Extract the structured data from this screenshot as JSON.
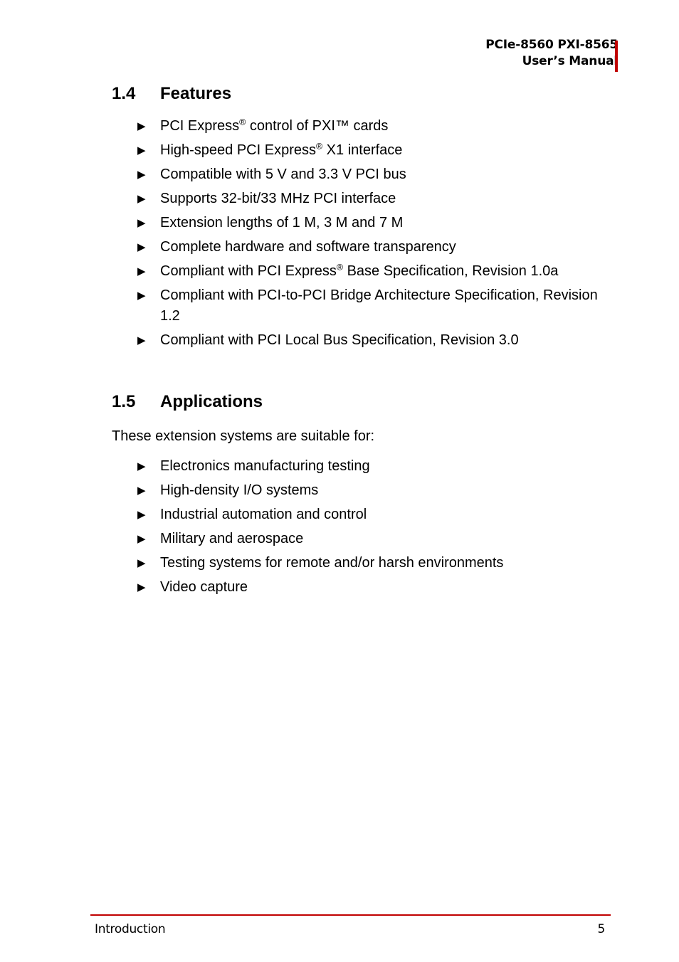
{
  "header": {
    "line1": "PCIe-8560 PXI-8565",
    "line2": "User’s Manual",
    "accent_color": "#c00000"
  },
  "sections": [
    {
      "number": "1.4",
      "title": "Features",
      "intro": "",
      "items": [
        {
          "parts": [
            {
              "t": "PCI Express"
            },
            {
              "sup": "®"
            },
            {
              "t": " control of PXI™ cards"
            }
          ]
        },
        {
          "parts": [
            {
              "t": "High-speed PCI Express"
            },
            {
              "sup": "®"
            },
            {
              "t": " X1 interface"
            }
          ]
        },
        {
          "parts": [
            {
              "t": "Compatible with 5 V and 3.3 V PCI bus"
            }
          ]
        },
        {
          "parts": [
            {
              "t": "Supports 32-bit/33 MHz PCI interface"
            }
          ]
        },
        {
          "parts": [
            {
              "t": "Extension lengths of 1 M, 3 M and 7 M"
            }
          ]
        },
        {
          "parts": [
            {
              "t": "Complete hardware and software transparency"
            }
          ]
        },
        {
          "parts": [
            {
              "t": "Compliant with PCI Express"
            },
            {
              "sup": "®"
            },
            {
              "t": " Base Specification, Revision 1.0a"
            }
          ]
        },
        {
          "parts": [
            {
              "t": "Compliant with PCI-to-PCI Bridge Architecture Specification, Revision 1.2"
            }
          ]
        },
        {
          "parts": [
            {
              "t": "Compliant with PCI Local Bus Specification, Revision 3.0"
            }
          ]
        }
      ]
    },
    {
      "number": "1.5",
      "title": "Applications",
      "intro": "These extension systems are suitable for:",
      "items": [
        {
          "parts": [
            {
              "t": "Electronics manufacturing testing"
            }
          ]
        },
        {
          "parts": [
            {
              "t": "High-density I/O systems"
            }
          ]
        },
        {
          "parts": [
            {
              "t": "Industrial automation and control"
            }
          ]
        },
        {
          "parts": [
            {
              "t": "Military and aerospace"
            }
          ]
        },
        {
          "parts": [
            {
              "t": "Testing systems for remote and/or harsh environments"
            }
          ]
        },
        {
          "parts": [
            {
              "t": "Video capture"
            }
          ]
        }
      ]
    }
  ],
  "bullet_glyph": "▶",
  "footer": {
    "chapter": "Introduction",
    "page_number": "5",
    "accent_color": "#c00000"
  }
}
